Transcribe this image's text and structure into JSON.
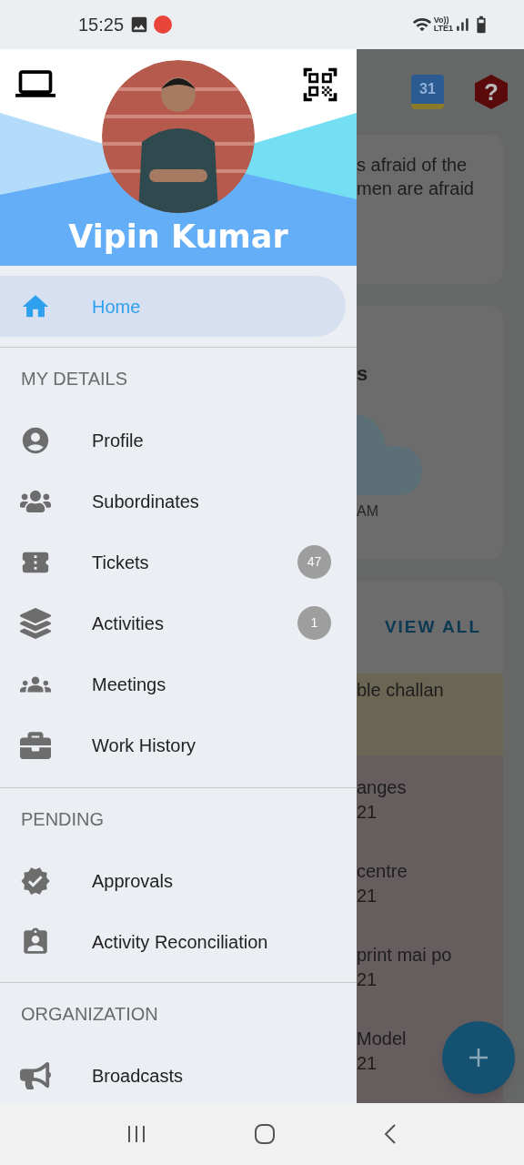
{
  "status_bar": {
    "time": "15:25",
    "volte": "Vo))",
    "network": "LTE1"
  },
  "drawer": {
    "user_name": "Vipin Kumar",
    "sections": [
      {
        "items": [
          {
            "label": "Home",
            "selected": true
          }
        ]
      },
      {
        "title": "MY DETAILS",
        "items": [
          {
            "label": "Profile",
            "selected": false
          },
          {
            "label": "Subordinates",
            "selected": false
          },
          {
            "label": "Tickets",
            "badge": "47",
            "selected": false
          },
          {
            "label": "Activities",
            "badge": "1",
            "selected": false
          },
          {
            "label": "Meetings",
            "selected": false
          },
          {
            "label": "Work History",
            "selected": false
          }
        ]
      },
      {
        "title": "PENDING",
        "items": [
          {
            "label": "Approvals",
            "selected": false
          },
          {
            "label": "Activity Reconciliation",
            "selected": false
          }
        ]
      },
      {
        "title": "ORGANIZATION",
        "items": [
          {
            "label": "Broadcasts",
            "selected": false
          }
        ]
      }
    ]
  },
  "background_screen": {
    "calendar_day": "31",
    "help": "?",
    "card_1_lines": [
      "s afraid of the",
      "men are afraid"
    ],
    "card_2_title": "s",
    "card_2_time": "AM",
    "card_3_action": "VIEW ALL",
    "card_3_rows": [
      {
        "title": "ble challan",
        "highlighted": true
      },
      {
        "title": "anges",
        "date": "21",
        "highlighted": false
      },
      {
        "title": "centre",
        "date": "21",
        "highlighted": false
      },
      {
        "title": "print mai po",
        "date": "21",
        "highlighted": false
      },
      {
        "title": "Model",
        "date": "21",
        "highlighted": false
      }
    ]
  }
}
